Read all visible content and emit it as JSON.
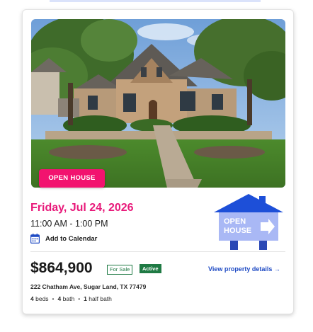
{
  "badge": {
    "open_house": "OPEN HOUSE"
  },
  "open_house": {
    "date": "Friday, Jul 24, 2026",
    "time": "11:00 AM - 1:00 PM",
    "add_to_calendar": "Add to Calendar",
    "sign_text_line1": "OPEN",
    "sign_text_line2": "HOUSE"
  },
  "listing": {
    "price": "$864,900",
    "status_label": "For Sale",
    "status_badge": "Active",
    "view_details": "View property details →",
    "address": "222 Chatham Ave, Sugar Land, TX 77479",
    "beds_count": "4",
    "beds_label": "beds",
    "bath_count": "4",
    "bath_label": "bath",
    "half_bath_count": "1",
    "half_bath_label": "half bath"
  },
  "colors": {
    "accent_pink": "#e8197a",
    "badge_pink": "#f2136f",
    "link_blue": "#1f4bc4",
    "status_green": "#1f7a44",
    "sign_roof": "#1d4fd8",
    "sign_body": "#a9b8f5"
  },
  "icons": {
    "calendar": "calendar-icon",
    "open_house_sign": "open-house-sign-icon"
  }
}
